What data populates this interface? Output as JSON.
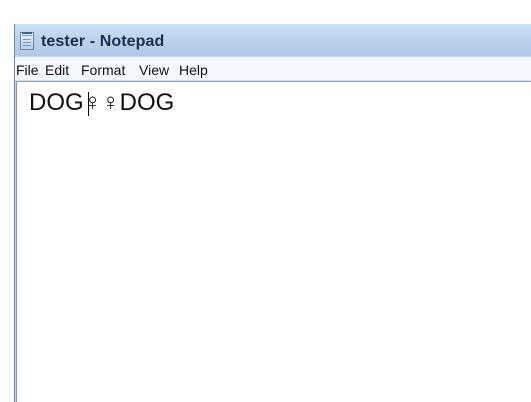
{
  "window": {
    "title": "tester - Notepad"
  },
  "menu": {
    "items": [
      "File",
      "Edit",
      "Format",
      "View",
      "Help"
    ]
  },
  "editor": {
    "text": "DOG♀♀DOG"
  },
  "icons": {
    "app_icon": "notepad-icon"
  },
  "colors": {
    "titlebar": "#bcd3ee",
    "menubar": "#f4f8fc",
    "editor_background": "#ffffff"
  }
}
